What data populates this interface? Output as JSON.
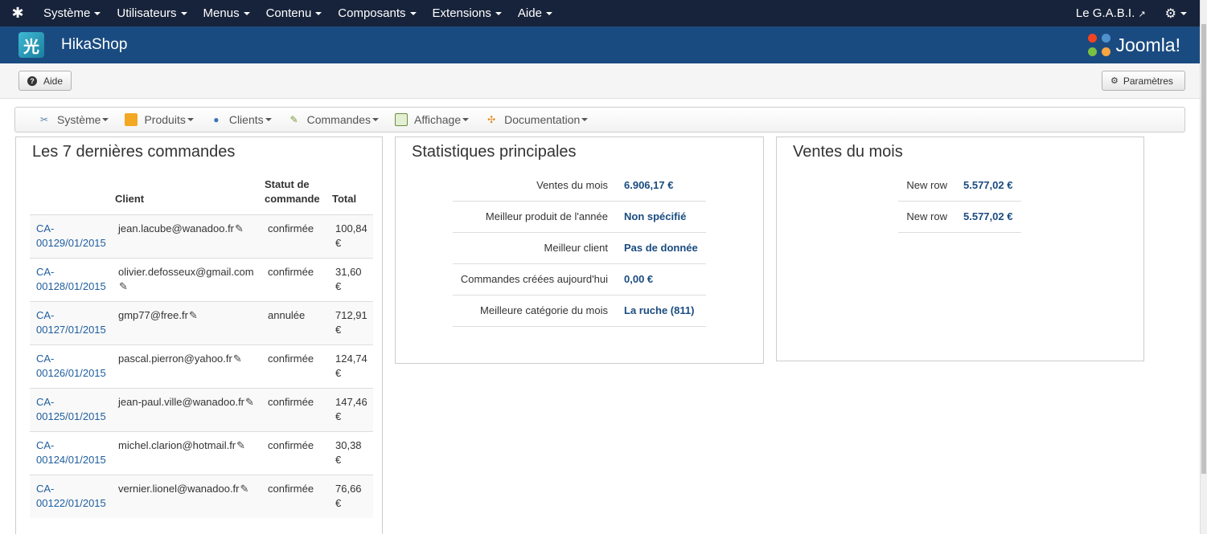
{
  "topbar": {
    "menu": [
      {
        "label": "Système"
      },
      {
        "label": "Utilisateurs"
      },
      {
        "label": "Menus"
      },
      {
        "label": "Contenu"
      },
      {
        "label": "Composants"
      },
      {
        "label": "Extensions"
      },
      {
        "label": "Aide"
      }
    ],
    "user": "Le G.A.B.I."
  },
  "header": {
    "app_title": "HikaShop",
    "brand": "Joomla!"
  },
  "toolbar": {
    "help_label": "Aide",
    "params_label": "Paramètres"
  },
  "submenu": {
    "items": [
      {
        "label": "Système"
      },
      {
        "label": "Produits"
      },
      {
        "label": "Clients"
      },
      {
        "label": "Commandes"
      },
      {
        "label": "Affichage"
      },
      {
        "label": "Documentation"
      }
    ]
  },
  "orders_panel": {
    "title": "Les 7 dernières commandes",
    "columns": {
      "client": "Client",
      "status": "Statut de commande",
      "total": "Total"
    },
    "rows": [
      {
        "num": "CA-00129/01/2015",
        "client": "jean.lacube@wanadoo.fr",
        "status": "confirmée",
        "total": "100,84 €"
      },
      {
        "num": "CA-00128/01/2015",
        "client": "olivier.defosseux@gmail.com",
        "status": "confirmée",
        "total": "31,60 €"
      },
      {
        "num": "CA-00127/01/2015",
        "client": "gmp77@free.fr",
        "status": "annulée",
        "total": "712,91 €"
      },
      {
        "num": "CA-00126/01/2015",
        "client": "pascal.pierron@yahoo.fr",
        "status": "confirmée",
        "total": "124,74 €"
      },
      {
        "num": "CA-00125/01/2015",
        "client": "jean-paul.ville@wanadoo.fr",
        "status": "confirmée",
        "total": "147,46 €"
      },
      {
        "num": "CA-00124/01/2015",
        "client": "michel.clarion@hotmail.fr",
        "status": "confirmée",
        "total": "30,38 €"
      },
      {
        "num": "CA-00122/01/2015",
        "client": "vernier.lionel@wanadoo.fr",
        "status": "confirmée",
        "total": "76,66 €"
      }
    ]
  },
  "stats_panel": {
    "title": "Statistiques principales",
    "rows": [
      {
        "label": "Ventes du mois",
        "value": "6.906,17 €"
      },
      {
        "label": "Meilleur produit de l'année",
        "value": "Non spécifié"
      },
      {
        "label": "Meilleur client",
        "value": "Pas de donnée"
      },
      {
        "label": "Commandes créées aujourd'hui",
        "value": "0,00 €"
      },
      {
        "label": "Meilleure catégorie du mois",
        "value": "La ruche (811)"
      }
    ]
  },
  "month_panel": {
    "title": "Ventes du mois",
    "rows": [
      {
        "label": "New row",
        "value": "5.577,02 €"
      },
      {
        "label": "New row",
        "value": "5.577,02 €"
      }
    ]
  }
}
